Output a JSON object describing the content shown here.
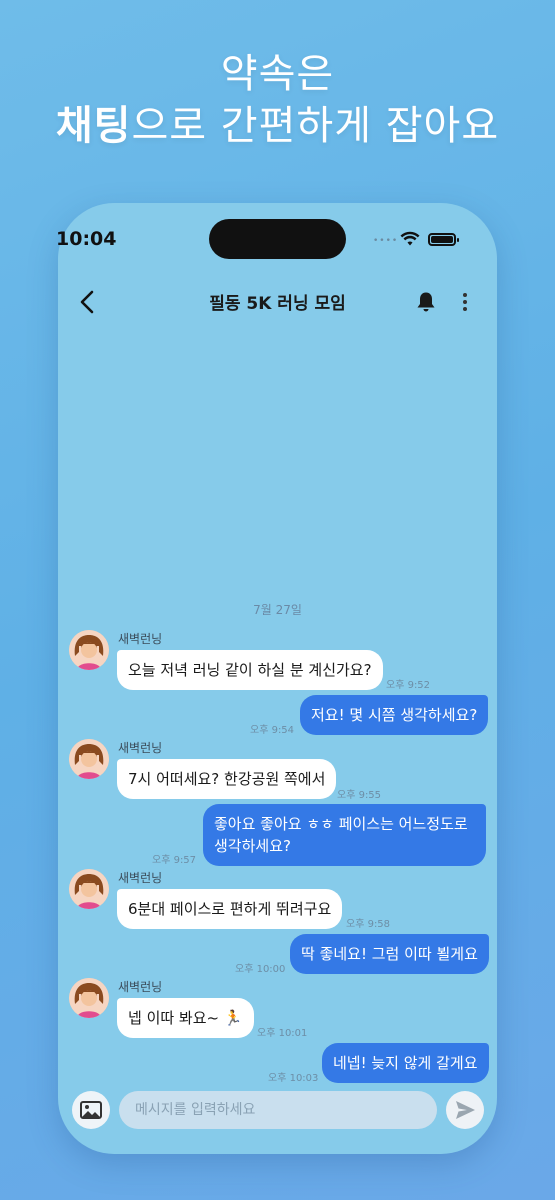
{
  "headline": {
    "line1": "약속은",
    "line2_bold": "채팅",
    "line2_rest": "으로 간편하게 잡아요"
  },
  "status_bar": {
    "time": "10:04",
    "dots": "••••"
  },
  "header": {
    "title": "필동 5K 러닝 모임"
  },
  "chat": {
    "date": "7월 27일",
    "messages": [
      {
        "dir": "in",
        "sender": "새벽런닝",
        "text": "오늘 저녁 러닝 같이 하실 분 계신가요?",
        "time": "오후 9:52"
      },
      {
        "dir": "out",
        "text": "저요! 몇 시쯤 생각하세요?",
        "time": "오후 9:54"
      },
      {
        "dir": "in",
        "sender": "새벽런닝",
        "text": "7시 어떠세요? 한강공원 쪽에서",
        "time": "오후 9:55"
      },
      {
        "dir": "out",
        "text": "좋아요 좋아요 ㅎㅎ 페이스는 어느정도로 생각하세요?",
        "time": "오후 9:57"
      },
      {
        "dir": "in",
        "sender": "새벽런닝",
        "text": "6분대 페이스로 편하게 뛰려구요",
        "time": "오후 9:58"
      },
      {
        "dir": "out",
        "text": "딱 좋네요! 그럼 이따 뵐게요",
        "time": "오후 10:00"
      },
      {
        "dir": "in",
        "sender": "새벽런닝",
        "text": "넵 이따 봐요~ 🏃",
        "time": "오후 10:01"
      },
      {
        "dir": "out",
        "text": "네넵! 늦지 않게 갈게요",
        "time": "오후 10:03"
      }
    ]
  },
  "input": {
    "placeholder": "메시지를 입력하세요"
  },
  "colors": {
    "background": "#6fbce9",
    "phone": "#86cbea",
    "outgoing": "#3479e6",
    "incoming": "#ffffff"
  },
  "icons": [
    "back-chevron-icon",
    "bell-icon",
    "more-vertical-icon",
    "image-icon",
    "send-icon",
    "wifi-icon",
    "battery-icon"
  ]
}
